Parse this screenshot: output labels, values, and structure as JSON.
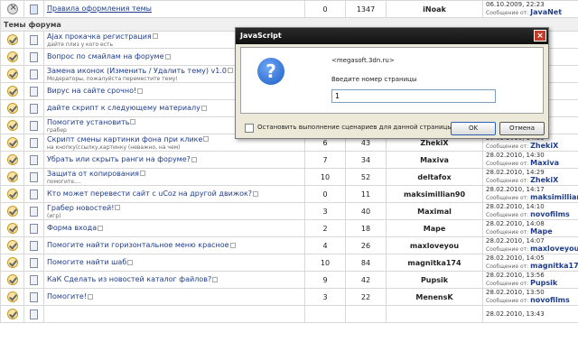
{
  "top_row": {
    "title": "Правила оформления темы",
    "replies": "0",
    "views": "1347",
    "author": "iNoak",
    "last_date": "06.10.2009, 22:23",
    "last_by_label": "Сообщение от:",
    "last_by": "JavaNet"
  },
  "section_label": "Темы форума",
  "topics": [
    {
      "title": "Ajax прокачка регистрация",
      "sub": "дайте плиз у кого есть",
      "replies": "",
      "views": "",
      "author": "",
      "last_date": "",
      "last_by_label": "",
      "last_by": ""
    },
    {
      "title": "Вопрос по смайлам на форуме",
      "sub": "",
      "replies": "",
      "views": "",
      "author": "",
      "last_date": "",
      "last_by_label": "",
      "last_by": ""
    },
    {
      "title": "Замена иконок (Изменить / Удалить тему) v1.0",
      "sub": "Модераторы, пожалуйста переместите тему!",
      "replies": "",
      "views": "",
      "author": "",
      "last_date": "",
      "last_by_label": "",
      "last_by": ""
    },
    {
      "title": "Вирус на сайте срочно!",
      "sub": "",
      "replies": "",
      "views": "",
      "author": "",
      "last_date": "",
      "last_by_label": "",
      "last_by": ""
    },
    {
      "title": "дайте скрипт к следующему материалу",
      "sub": "",
      "replies": "",
      "views": "",
      "author": "",
      "last_date": "",
      "last_by_label": "",
      "last_by": ""
    },
    {
      "title": "Помогите установить",
      "sub": "грабер",
      "replies": "",
      "views": "",
      "author": "",
      "last_date": "",
      "last_by_label": "",
      "last_by": ""
    },
    {
      "title": "Скрипт смены картинки фона при клике",
      "sub": "на кнопку(ссылку,картинку (неважно, на чем)",
      "replies": "6",
      "views": "43",
      "author": "ZhekiX",
      "last_date": "28.02.2010, 14:33",
      "last_by_label": "Сообщение от:",
      "last_by": "ZhekiX"
    },
    {
      "title": "Убрать или скрыть ранги на форуме?",
      "sub": "",
      "replies": "7",
      "views": "34",
      "author": "Maxiva",
      "last_date": "28.02.2010, 14:30",
      "last_by_label": "Сообщение от:",
      "last_by": "Maxiva"
    },
    {
      "title": "Защита от копирования",
      "sub": "помогите....",
      "replies": "10",
      "views": "52",
      "author": "deltafox",
      "last_date": "28.02.2010, 14:29",
      "last_by_label": "Сообщение от:",
      "last_by": "ZhekiX"
    },
    {
      "title": "Кто может перевести сайт с uCoz на другой движок?",
      "sub": "",
      "replies": "0",
      "views": "11",
      "author": "maksimillian90",
      "last_date": "28.02.2010, 14:17",
      "last_by_label": "Сообщение от:",
      "last_by": "maksimillian90"
    },
    {
      "title": "Грабер новостей!",
      "sub": "(игр)",
      "replies": "3",
      "views": "40",
      "author": "Maximal",
      "last_date": "28.02.2010, 14:10",
      "last_by_label": "Сообщение от:",
      "last_by": "novofilms"
    },
    {
      "title": "Форма входа",
      "sub": "",
      "replies": "2",
      "views": "18",
      "author": "Mape",
      "last_date": "28.02.2010, 14:08",
      "last_by_label": "Сообщение от:",
      "last_by": "Mape"
    },
    {
      "title": "Помогите найти горизонтальное меню красное",
      "sub": "",
      "replies": "4",
      "views": "26",
      "author": "maxloveyou",
      "last_date": "28.02.2010, 14:07",
      "last_by_label": "Сообщение от:",
      "last_by": "maxloveyou"
    },
    {
      "title": "Помогите найти шаб",
      "sub": "",
      "replies": "10",
      "views": "84",
      "author": "magnitka174",
      "last_date": "28.02.2010, 14:05",
      "last_by_label": "Сообщение от:",
      "last_by": "magnitka174"
    },
    {
      "title": "КаК Сделать из новостей каталог файлов?",
      "sub": "",
      "replies": "9",
      "views": "42",
      "author": "Pupsik",
      "last_date": "28.02.2010, 13:56",
      "last_by_label": "Сообщение от:",
      "last_by": "Pupsik"
    },
    {
      "title": "Помогите!",
      "sub": "",
      "replies": "3",
      "views": "22",
      "author": "MenensK",
      "last_date": "28.02.2010, 13:50",
      "last_by_label": "Сообщение от:",
      "last_by": "novofilms"
    },
    {
      "title": "",
      "sub": "",
      "replies": "",
      "views": "",
      "author": "",
      "last_date": "28.02.2010, 13:43",
      "last_by_label": "",
      "last_by": ""
    }
  ],
  "dialog": {
    "title": "JavaScript",
    "close_glyph": "×",
    "icon_glyph": "?",
    "host": "<megasoft.3dn.ru>",
    "prompt": "Введите номер страницы",
    "input_value": "1",
    "checkbox_label": "Остановить выполнение сценариев для данной страницы",
    "ok_label": "OK",
    "cancel_label": "Отмена"
  }
}
